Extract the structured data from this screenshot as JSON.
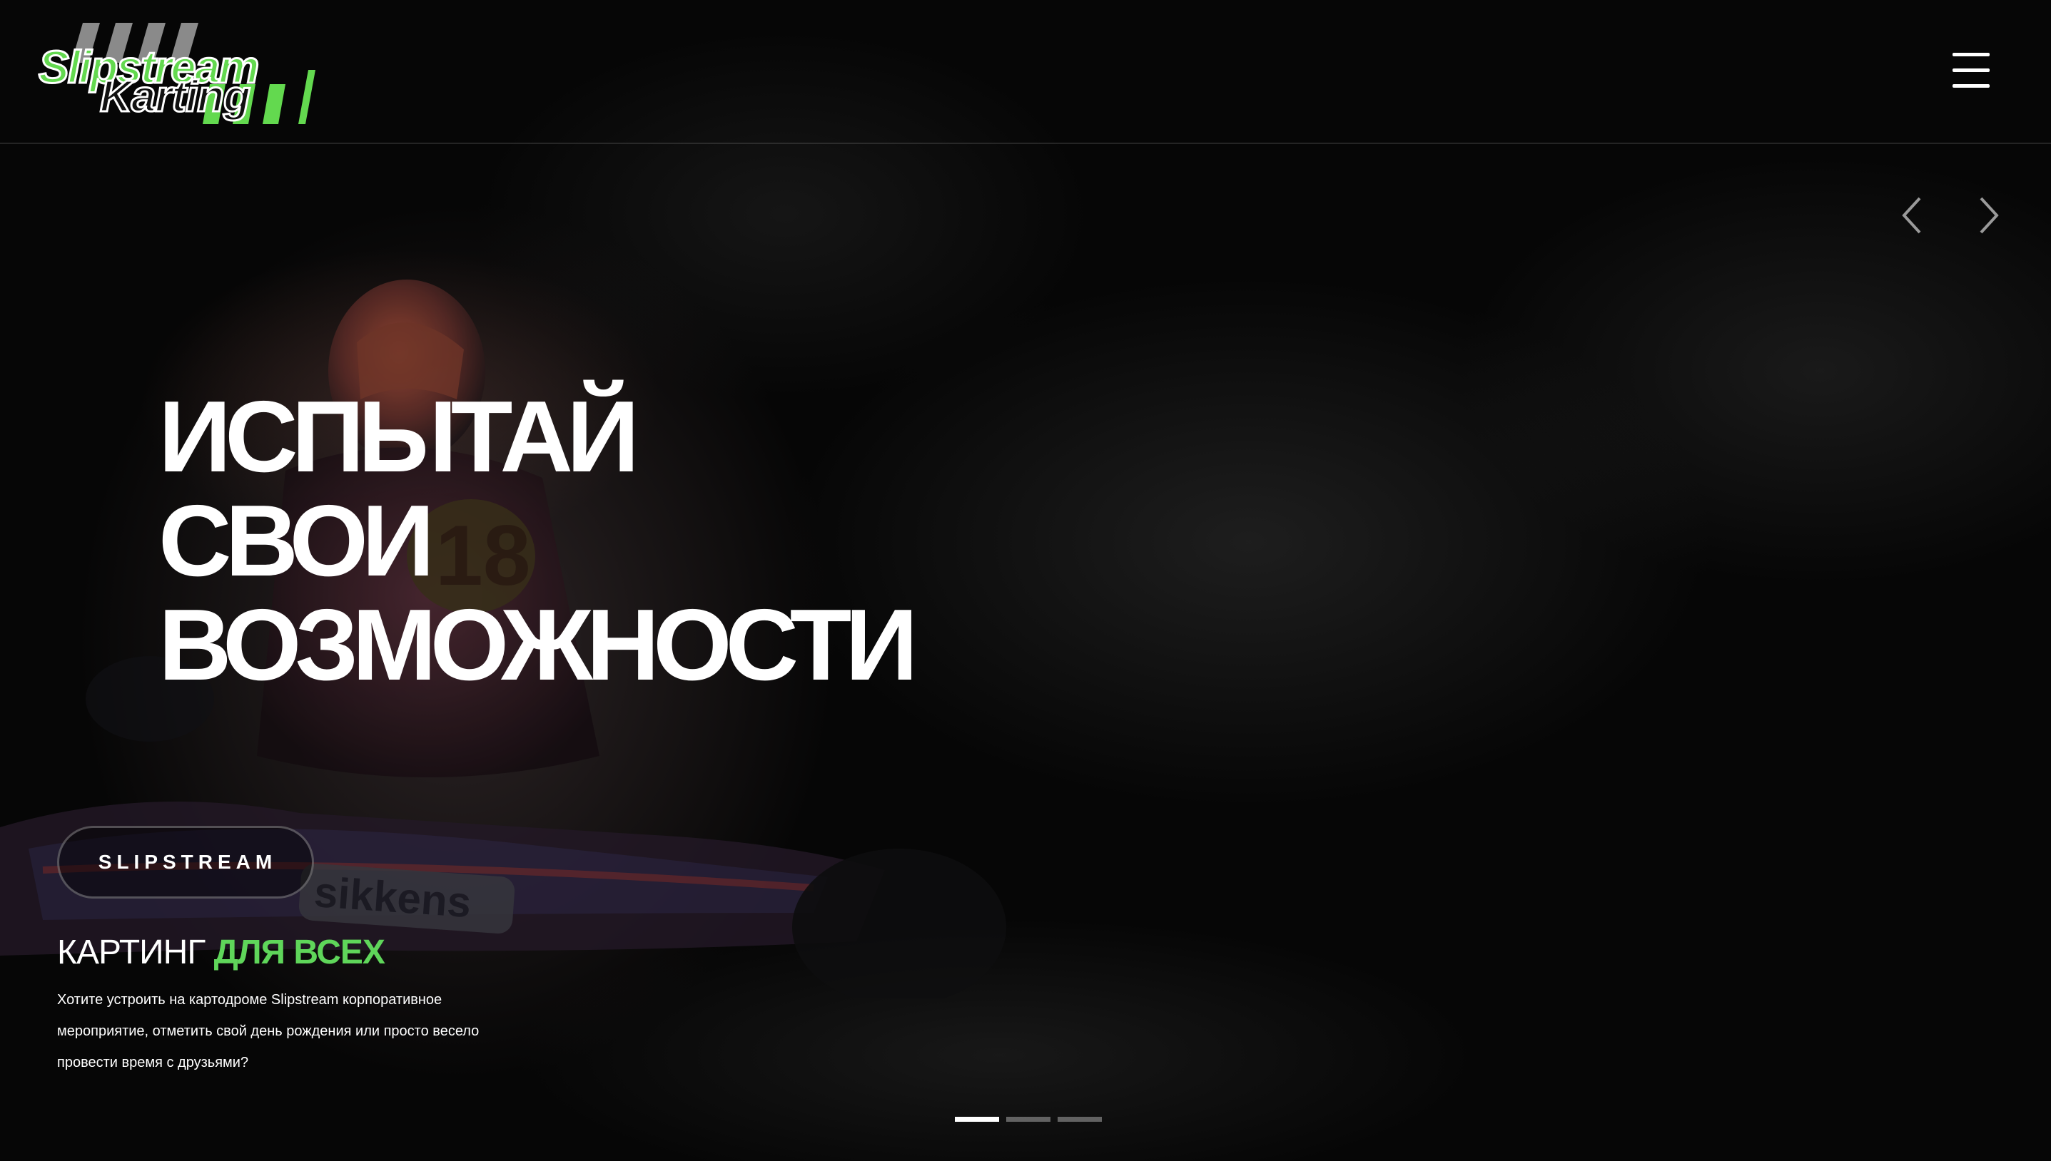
{
  "logo": {
    "line1": "Slipstream",
    "line2": "Karting",
    "accent_color": "#63d94f"
  },
  "header": {
    "menu_icon": "hamburger-menu-icon"
  },
  "slider": {
    "prev_icon": "chevron-left-icon",
    "next_icon": "chevron-right-icon",
    "slide_count": 3,
    "active_slide": 1
  },
  "hero": {
    "headline_lines": [
      "ИСПЫТАЙ",
      "СВОИ",
      "ВОЗМОЖНОСТИ"
    ],
    "brand_button": "SLIPSTREAM",
    "subtitle_plain": "КАРТИНГ",
    "subtitle_accent": "ДЛЯ ВСЕХ",
    "description": "Хотите устроить на картодроме Slipstream корпоративное мероприятие, отметить свой день рождения или просто весело провести время с друзьями?"
  },
  "colors": {
    "accent": "#5fd65a",
    "background": "#050505",
    "text": "#ffffff"
  }
}
